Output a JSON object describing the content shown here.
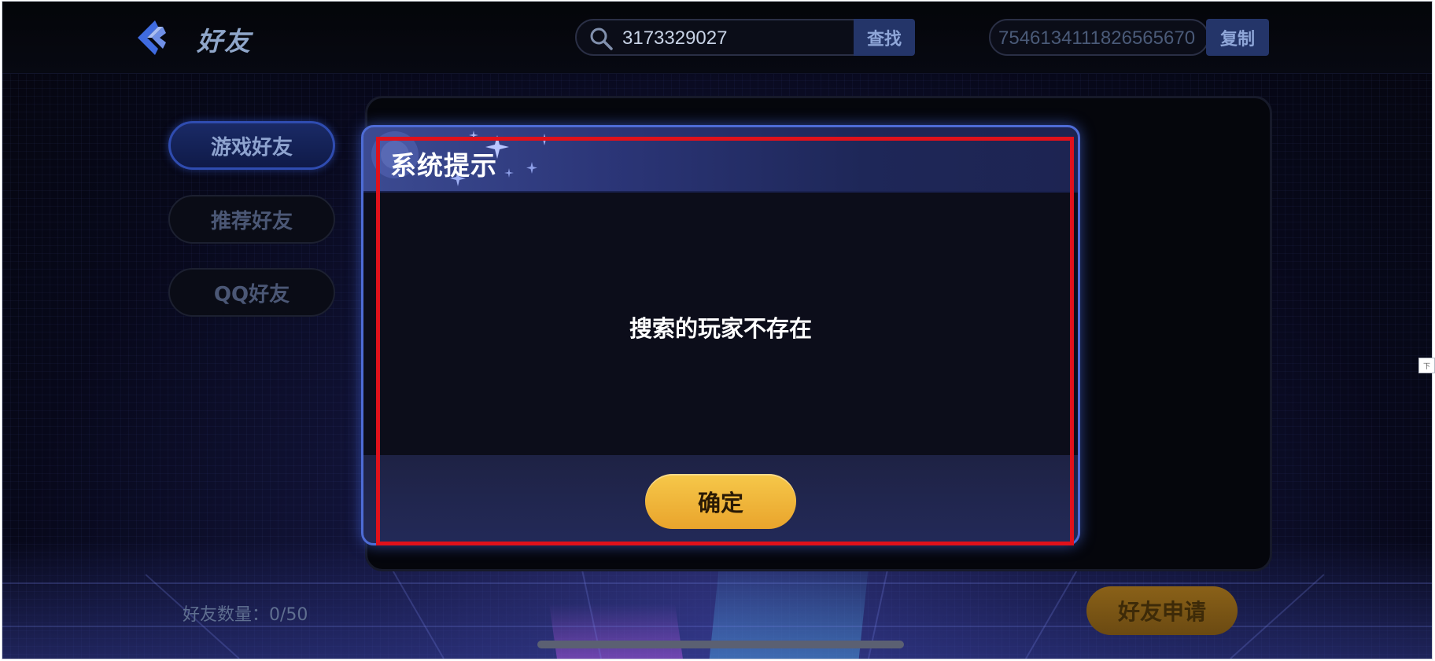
{
  "header": {
    "title": "好友",
    "back_icon": "back-arrow-icon"
  },
  "search": {
    "value": "3173329027",
    "placeholder": "",
    "button_label": "查找",
    "icon": "search-icon"
  },
  "my_id": {
    "value": "7546134111826565670",
    "copy_label": "复制"
  },
  "sidebar": {
    "items": [
      {
        "label": "游戏好友",
        "active": true
      },
      {
        "label": "推荐好友",
        "active": false
      },
      {
        "label": "QQ好友",
        "active": false
      }
    ]
  },
  "footer": {
    "friend_count_label": "好友数量：",
    "friend_count_value": "0/50",
    "friend_request_label": "好友申请"
  },
  "dialog": {
    "title": "系统提示",
    "message": "搜索的玩家不存在",
    "confirm_label": "确定"
  },
  "side_marker": {
    "text": "下"
  },
  "colors": {
    "accent_blue": "#2f4cb0",
    "confirm_gold": "#f0b83a",
    "highlight_red": "#e0111b"
  }
}
